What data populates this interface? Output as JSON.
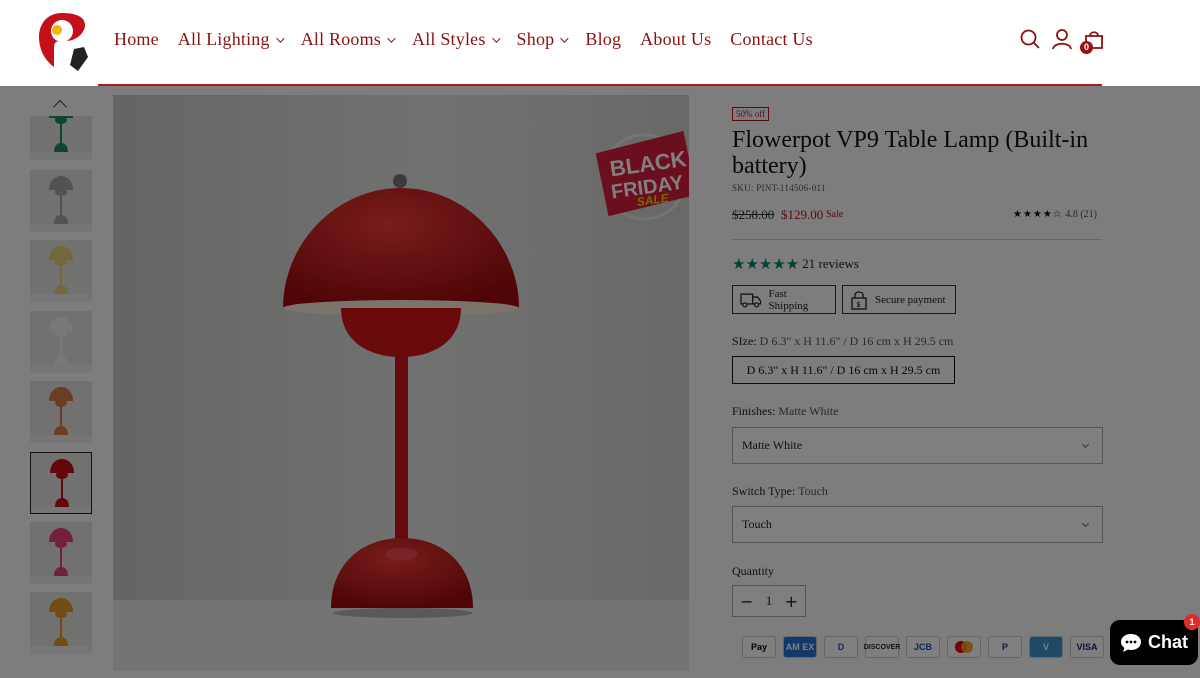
{
  "nav": {
    "items": [
      {
        "label": "Home",
        "dropdown": false
      },
      {
        "label": "All Lighting",
        "dropdown": true
      },
      {
        "label": "All Rooms",
        "dropdown": true
      },
      {
        "label": "All Styles",
        "dropdown": true
      },
      {
        "label": "Shop",
        "dropdown": true
      },
      {
        "label": "Blog",
        "dropdown": false
      },
      {
        "label": "About Us",
        "dropdown": false
      },
      {
        "label": "Contact Us",
        "dropdown": false
      }
    ],
    "icons": [
      "search-icon",
      "account-icon",
      "cart-icon"
    ],
    "cart_count": "0"
  },
  "gallery": {
    "promo_line1": "BLACK",
    "promo_line2": "FRIDAY",
    "promo_line3": "SALE",
    "thumbnail_colors": [
      "#1f8a5a",
      "#a9a2a8",
      "#e3d07a",
      "#f0f0f0",
      "#d97a4a",
      "#c4101a",
      "#e4417e",
      "#e49a24"
    ],
    "active_thumbnail": 5
  },
  "product": {
    "discount_badge": "50% off",
    "title": "Flowerpot VP9 Table Lamp (Built-in battery)",
    "sku": "SKU: PINT-114506-011",
    "price_old": "$258.00",
    "price_new": "$129.00",
    "sale_label": "Sale",
    "rating_stars": "★★★★☆",
    "rating_text": "4.8 (21)",
    "reviews_stars": "★★★★★",
    "reviews_text": "21 reviews",
    "trust_shipping": "Fast Shipping",
    "trust_payment": "Secure payment",
    "size_label": "SIze:",
    "size_value": "D 6.3\" x H 11.6\" / D 16 cm x H 29.5 cm",
    "size_option": "D 6.3\" x H 11.6\" / D 16 cm x H 29.5 cm",
    "finishes_label": "Finishes:",
    "finishes_value": "Matte White",
    "finishes_selected": "Matte White",
    "switch_label": "Switch Type:",
    "switch_value": "Touch",
    "switch_selected": "Touch",
    "quantity_label": "Quantity",
    "quantity_value": "1",
    "qty_minus": "−",
    "qty_plus": "+"
  },
  "payments": [
    {
      "name": "apple-pay",
      "label": "Pay",
      "bg": "#ffffff",
      "fg": "#000000"
    },
    {
      "name": "amex",
      "label": "AM EX",
      "bg": "#2673d6",
      "fg": "#ffffff"
    },
    {
      "name": "diners",
      "label": "D",
      "bg": "#ffffff",
      "fg": "#1a5aa8"
    },
    {
      "name": "discover",
      "label": "DISCOVER",
      "bg": "#ffffff",
      "fg": "#222222"
    },
    {
      "name": "jcb",
      "label": "JCB",
      "bg": "#ffffff",
      "fg": "#1a4aa0"
    },
    {
      "name": "mastercard",
      "label": "",
      "bg": "#ffffff",
      "fg": "#000000"
    },
    {
      "name": "paypal",
      "label": "P",
      "bg": "#ffffff",
      "fg": "#1b3a8c"
    },
    {
      "name": "venmo",
      "label": "V",
      "bg": "#3d95ce",
      "fg": "#ffffff"
    },
    {
      "name": "visa",
      "label": "VISA",
      "bg": "#ffffff",
      "fg": "#1a1f71"
    }
  ],
  "chat": {
    "label": "Chat",
    "badge": "1"
  },
  "colors": {
    "brand": "#b01a1a",
    "nav_text": "#8a1111",
    "review_star": "#06856e"
  }
}
